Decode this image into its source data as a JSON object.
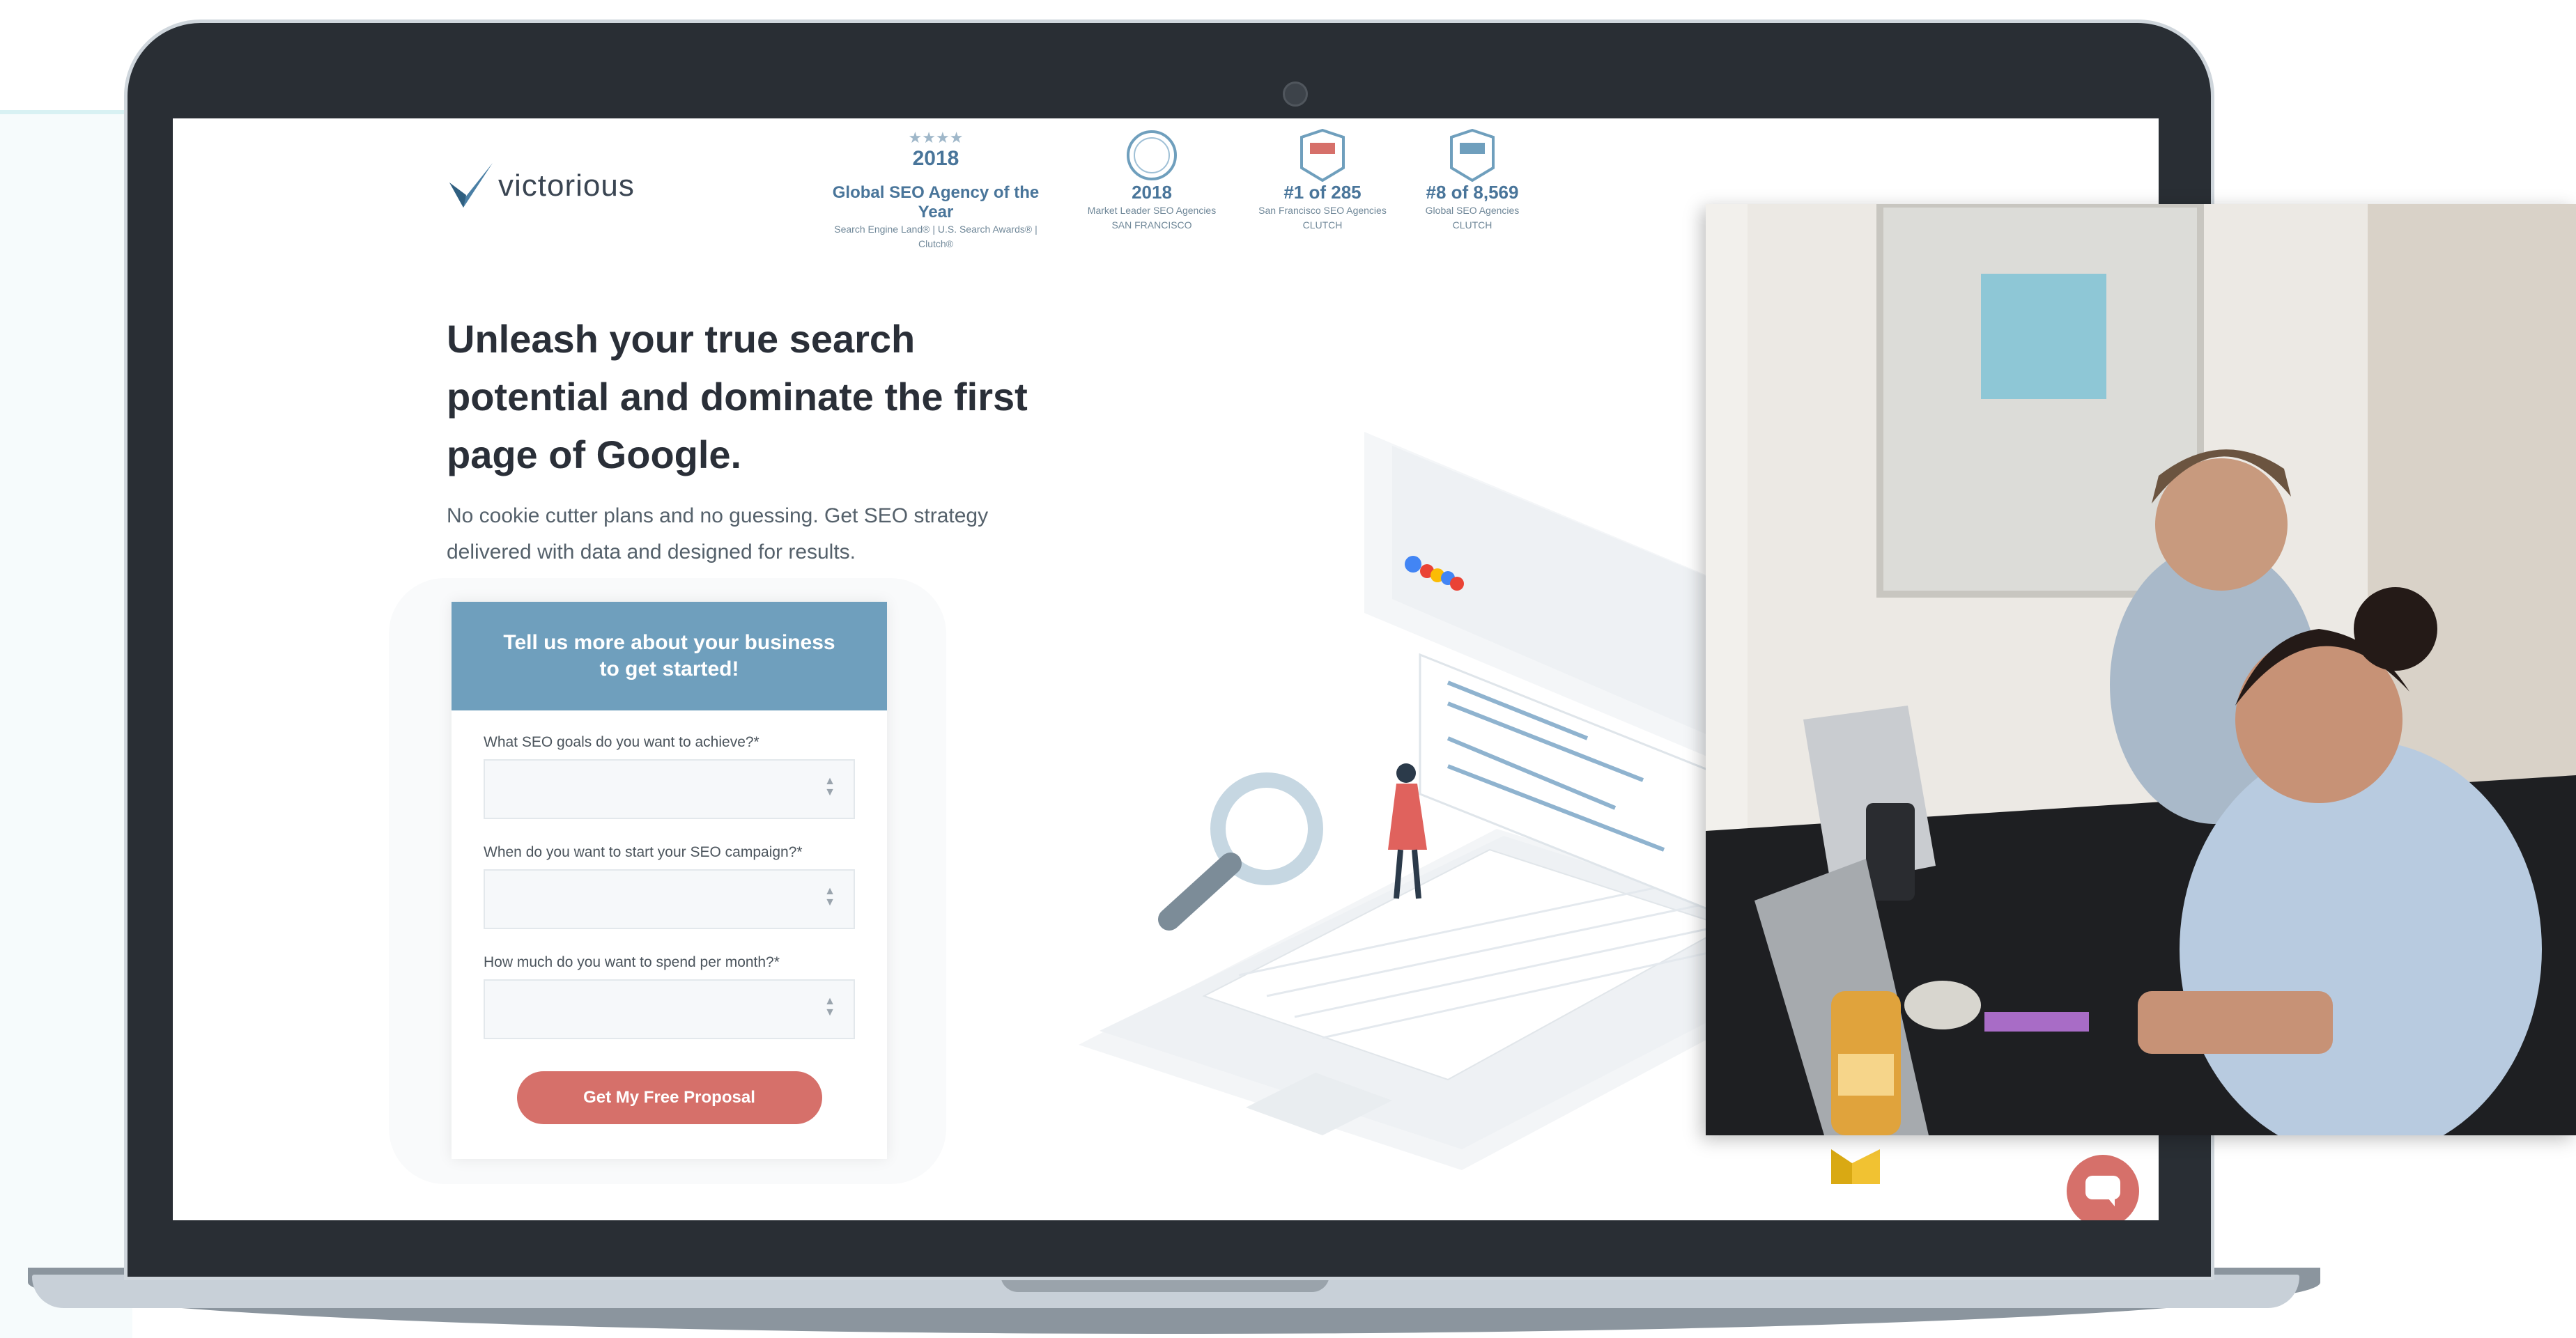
{
  "header": {
    "logo_text": "victorious",
    "awards": [
      {
        "stars": "★★★★",
        "year": "2018",
        "title": "Global SEO Agency of the Year",
        "sub": "Search Engine Land® | U.S. Search Awards® | Clutch®"
      },
      {
        "year": "2018",
        "title": "Market Leader SEO Agencies",
        "sub": "SAN FRANCISCO"
      },
      {
        "big": "#1 of 285",
        "title": "San Francisco SEO Agencies",
        "sub": "CLUTCH"
      },
      {
        "big": "#8 of 8,569",
        "title": "Global SEO Agencies",
        "sub": "CLUTCH"
      }
    ]
  },
  "hero": {
    "title": "Unleash your true search potential and dominate the first page of Google.",
    "subtitle": "No cookie cutter plans and no guessing. Get SEO strategy delivered with data and designed for results."
  },
  "form": {
    "heading": "Tell us more about your business to get started!",
    "fields": [
      {
        "label": "What SEO goals do you want to achieve?*"
      },
      {
        "label": "When do you want to start your SEO campaign?*"
      },
      {
        "label": "How much do you want to spend per month?*"
      }
    ],
    "submit_label": "Get My Free Proposal"
  },
  "colors": {
    "brand": "#6f9fbd",
    "accent": "#d6706a",
    "text_dark": "#2a2f38"
  },
  "icons": {
    "logo": "checkmark-logo-icon",
    "chat": "chat-bubble-icon",
    "select": "up-down-arrows-icon"
  }
}
